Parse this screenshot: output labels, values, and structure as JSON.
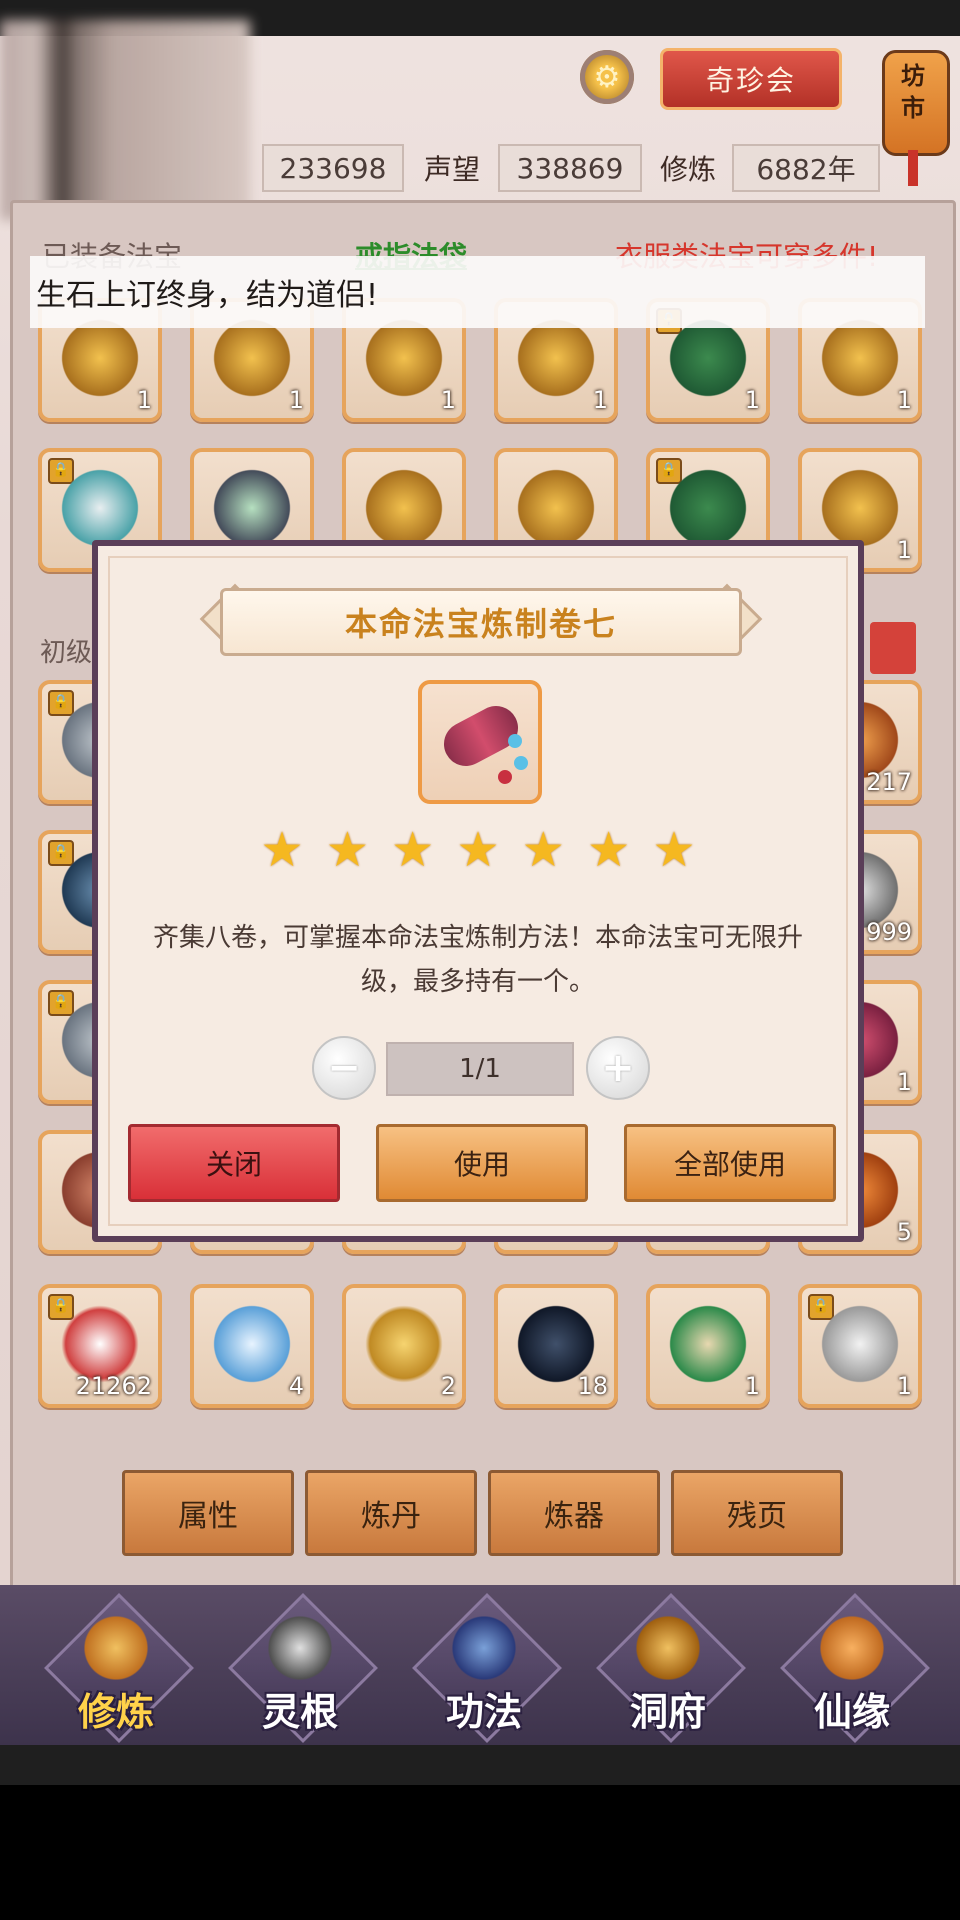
{
  "header": {
    "treasure_button": "奇珍会",
    "market_label": "坊市",
    "stats": [
      {
        "label": "",
        "value": "233698"
      },
      {
        "label": "声望",
        "value": "338869"
      },
      {
        "label": "修炼",
        "value": "6882年"
      }
    ]
  },
  "inventory": {
    "tab_equipped": "已装备法宝",
    "tab_ring": "戒指法袋",
    "hint": "衣服类法宝可穿多件!",
    "section_label": "初级",
    "notice": "生石上订终身，结为道侣!",
    "row1_counts": [
      "1",
      "1",
      "1",
      "1",
      "1",
      "1"
    ],
    "row2_counts": [
      "",
      "",
      "",
      "",
      "",
      "1"
    ],
    "right_column_counts": [
      "217",
      "999",
      "1",
      "5"
    ],
    "row_last_counts": [
      "21262",
      "4",
      "2",
      "18",
      "1",
      "1"
    ]
  },
  "craft_buttons": [
    "属性",
    "炼丹",
    "炼器",
    "残页"
  ],
  "nav": [
    {
      "label": "修炼",
      "active": true
    },
    {
      "label": "灵根",
      "active": false
    },
    {
      "label": "功法",
      "active": false
    },
    {
      "label": "洞府",
      "active": false
    },
    {
      "label": "仙缘",
      "active": false
    }
  ],
  "modal": {
    "title": "本命法宝炼制卷七",
    "item_icon": "scroll-icon",
    "stars": 7,
    "description": "齐集八卷，可掌握本命法宝炼制方法！本命法宝可无限升级，最多持有一个。",
    "quantity": "1/1",
    "minus_label": "−",
    "plus_label": "+",
    "close_label": "关闭",
    "use_label": "使用",
    "use_all_label": "全部使用"
  },
  "colors": {
    "accent_orange": "#e08a34",
    "close_red": "#d93038",
    "title_gold": "#c9821e",
    "hint_red": "#d6362c",
    "ring_green": "#2c8c2a"
  }
}
